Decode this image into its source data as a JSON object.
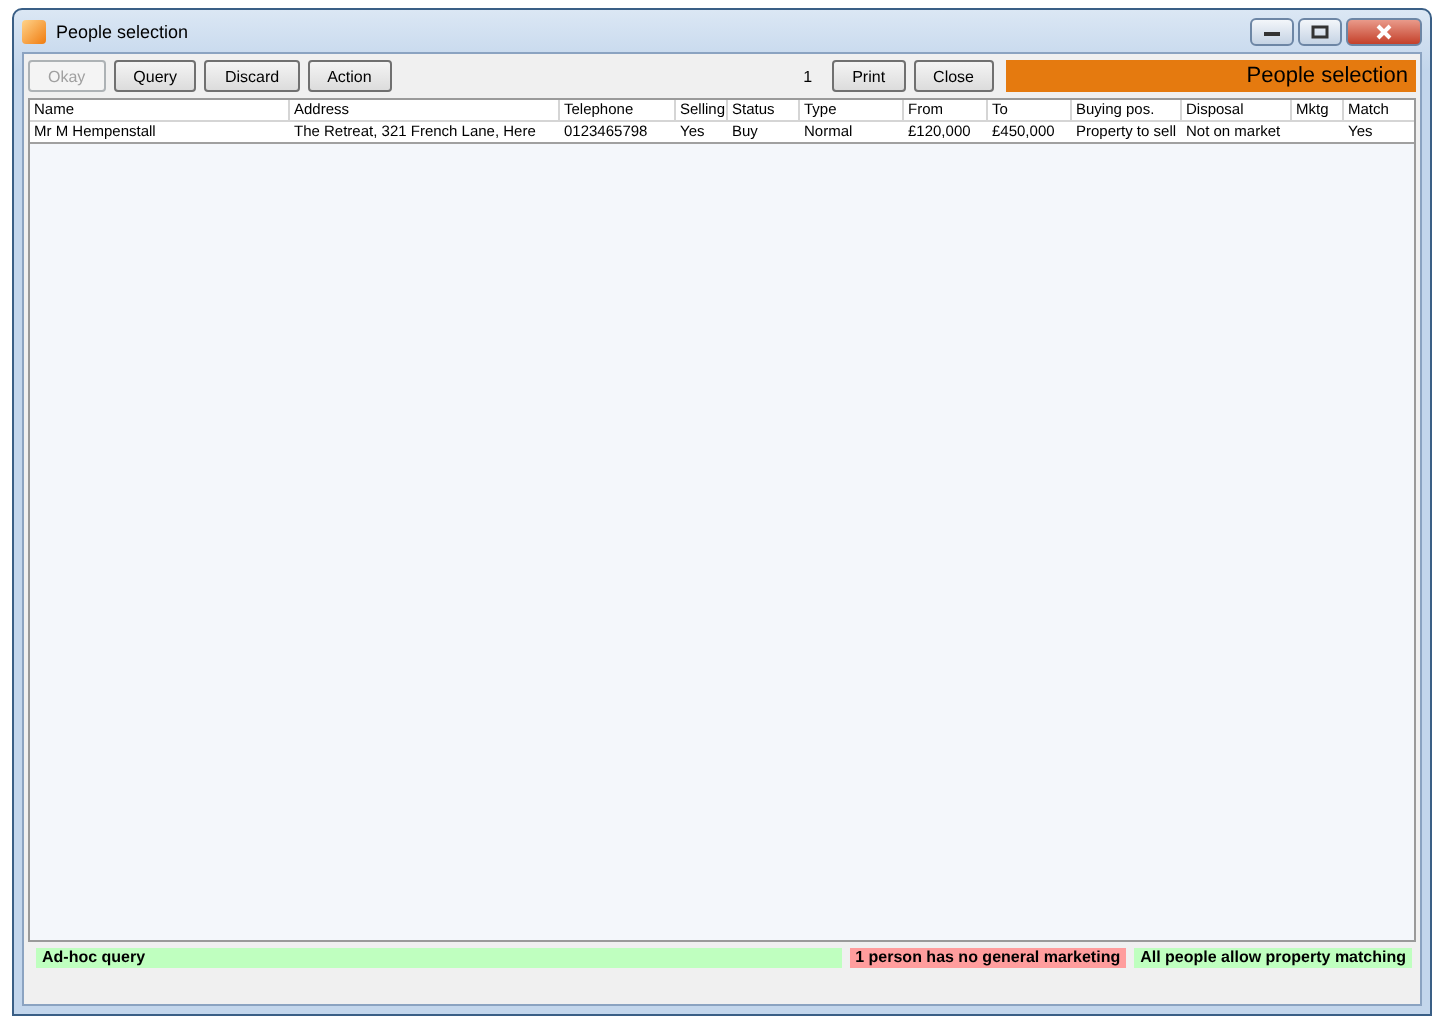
{
  "window": {
    "title": "People selection"
  },
  "toolbar": {
    "buttons": [
      {
        "label": "Okay",
        "disabled": true
      },
      {
        "label": "Query",
        "disabled": false
      },
      {
        "label": "Discard",
        "disabled": false
      },
      {
        "label": "Action",
        "disabled": false
      }
    ],
    "count": "1",
    "right_buttons": [
      {
        "label": "Print",
        "disabled": false
      },
      {
        "label": "Close",
        "disabled": false
      }
    ],
    "banner": "People selection"
  },
  "table": {
    "columns": [
      "Name",
      "Address",
      "Telephone",
      "Selling",
      "Status",
      "Type",
      "From",
      "To",
      "Buying pos.",
      "Disposal",
      "Mktg",
      "Match"
    ],
    "rows": [
      [
        "Mr M Hempenstall",
        "The Retreat, 321 French Lane, Here",
        "0123465798",
        "Yes",
        "Buy",
        "Normal",
        "£120,000",
        "£450,000",
        "Property to sell",
        "Not on market",
        "",
        "Yes"
      ]
    ]
  },
  "status_bar": [
    {
      "text": "Ad-hoc query",
      "color": "#bfffbf"
    },
    {
      "text": "1 person has no general marketing",
      "color": "#ff9d9d"
    },
    {
      "text": "All people allow property matching",
      "color": "#bfffbf"
    }
  ]
}
